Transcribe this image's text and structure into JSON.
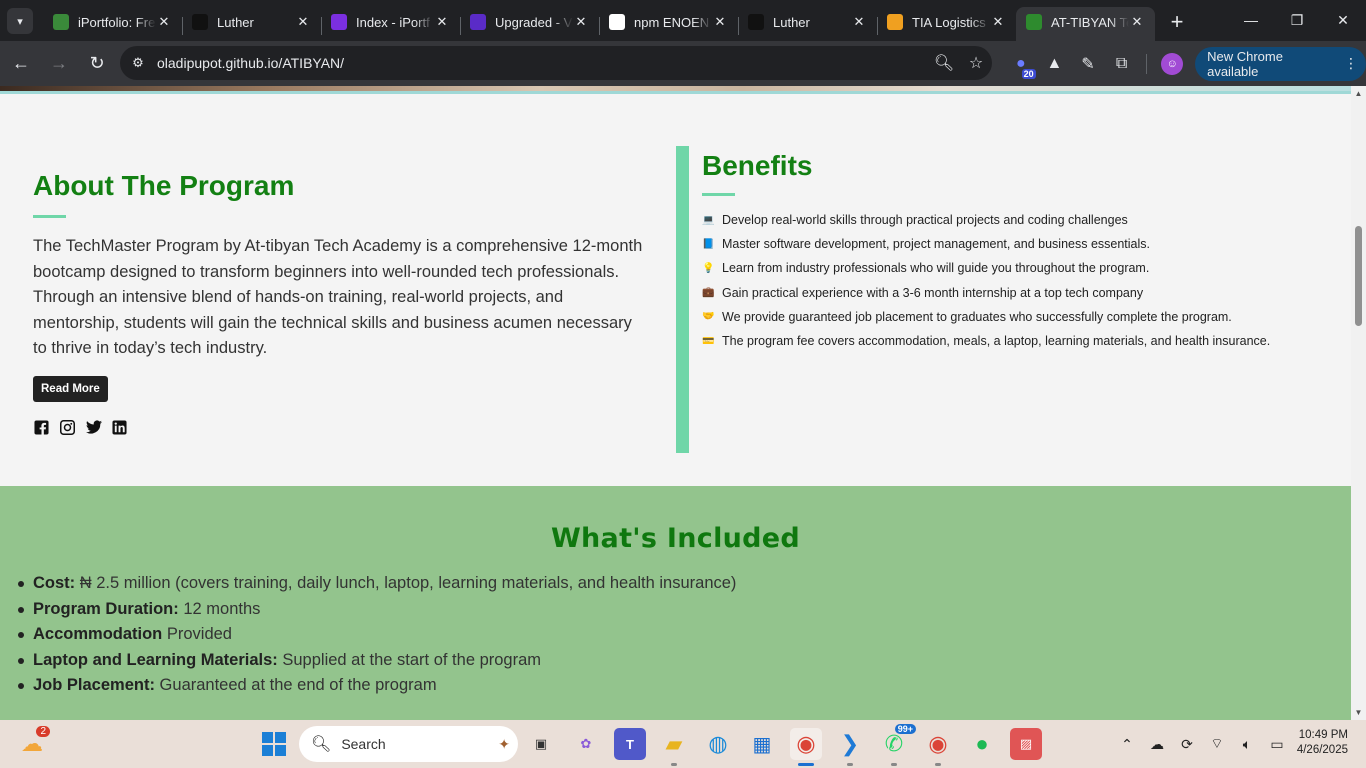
{
  "browser": {
    "tabs": [
      {
        "title": "iPortfolio: Fre",
        "icon": "iportfolio-icon",
        "color": "#3a8a3a"
      },
      {
        "title": "Luther",
        "icon": "luther-icon",
        "color": "#111111"
      },
      {
        "title": "Index - iPortf",
        "icon": "bootstrap-icon",
        "color": "#7b2fe0"
      },
      {
        "title": "Upgraded - V",
        "icon": "upgraded-icon",
        "color": "#5a2bc7"
      },
      {
        "title": "npm ENOEN",
        "icon": "openai-icon",
        "color": "#ffffff"
      },
      {
        "title": "Luther",
        "icon": "luther-icon",
        "color": "#111111"
      },
      {
        "title": "TIA Logistics",
        "icon": "tia-icon",
        "color": "#f0a020"
      },
      {
        "title": "AT-TIBYAN Te",
        "icon": "tree-icon",
        "color": "#2e8b2e",
        "active": true
      }
    ],
    "url": "oladipupot.github.io/ATIBYAN/",
    "extension_badge": "20",
    "update_label": "New Chrome available"
  },
  "about": {
    "title": "About The Program",
    "text": "The TechMaster Program by At-tibyan Tech Academy is a comprehensive 12-month bootcamp designed to transform beginners into well-rounded tech professionals. Through an intensive blend of hands-on training, real-world projects, and mentorship, students will gain the technical skills and business acumen necessary to thrive in today’s tech industry.",
    "button": "Read More",
    "socials": [
      "facebook-icon",
      "instagram-icon",
      "twitter-icon",
      "linkedin-icon"
    ]
  },
  "benefits": {
    "title": "Benefits",
    "items": [
      {
        "icon": "laptop-icon",
        "glyph": "💻",
        "text": "Develop real-world skills through practical projects and coding challenges"
      },
      {
        "icon": "book-icon",
        "glyph": "📘",
        "text": "Master software development, project management, and business essentials."
      },
      {
        "icon": "lightbulb-icon",
        "glyph": "💡",
        "text": "Learn from industry professionals who will guide you throughout the program."
      },
      {
        "icon": "briefcase-icon",
        "glyph": "💼",
        "text": "Gain practical experience with a 3-6 month internship at a top tech company"
      },
      {
        "icon": "handshake-icon",
        "glyph": "🤝",
        "text": "We provide guaranteed job placement to graduates who successfully complete the program."
      },
      {
        "icon": "wallet-icon",
        "glyph": "💳",
        "text": "The program fee covers accommodation, meals, a laptop, learning materials, and health insurance."
      }
    ]
  },
  "included": {
    "title": "What's Included",
    "items": [
      {
        "label": "Cost:",
        "value": " ₦ 2.5 million (covers training, daily lunch, laptop, learning materials, and health insurance)"
      },
      {
        "label": "Program Duration:",
        "value": " 12 months"
      },
      {
        "label": "Accommodation",
        "value": " Provided"
      },
      {
        "label": "Laptop and Learning Materials:",
        "value": " Supplied at the start of the program"
      },
      {
        "label": "Job Placement:",
        "value": " Guaranteed at the end of the program"
      }
    ]
  },
  "taskbar": {
    "weather_badge": "2",
    "search_placeholder": "Search",
    "whatsapp_badge": "99+",
    "time": "10:49 PM",
    "date": "4/26/2025"
  }
}
